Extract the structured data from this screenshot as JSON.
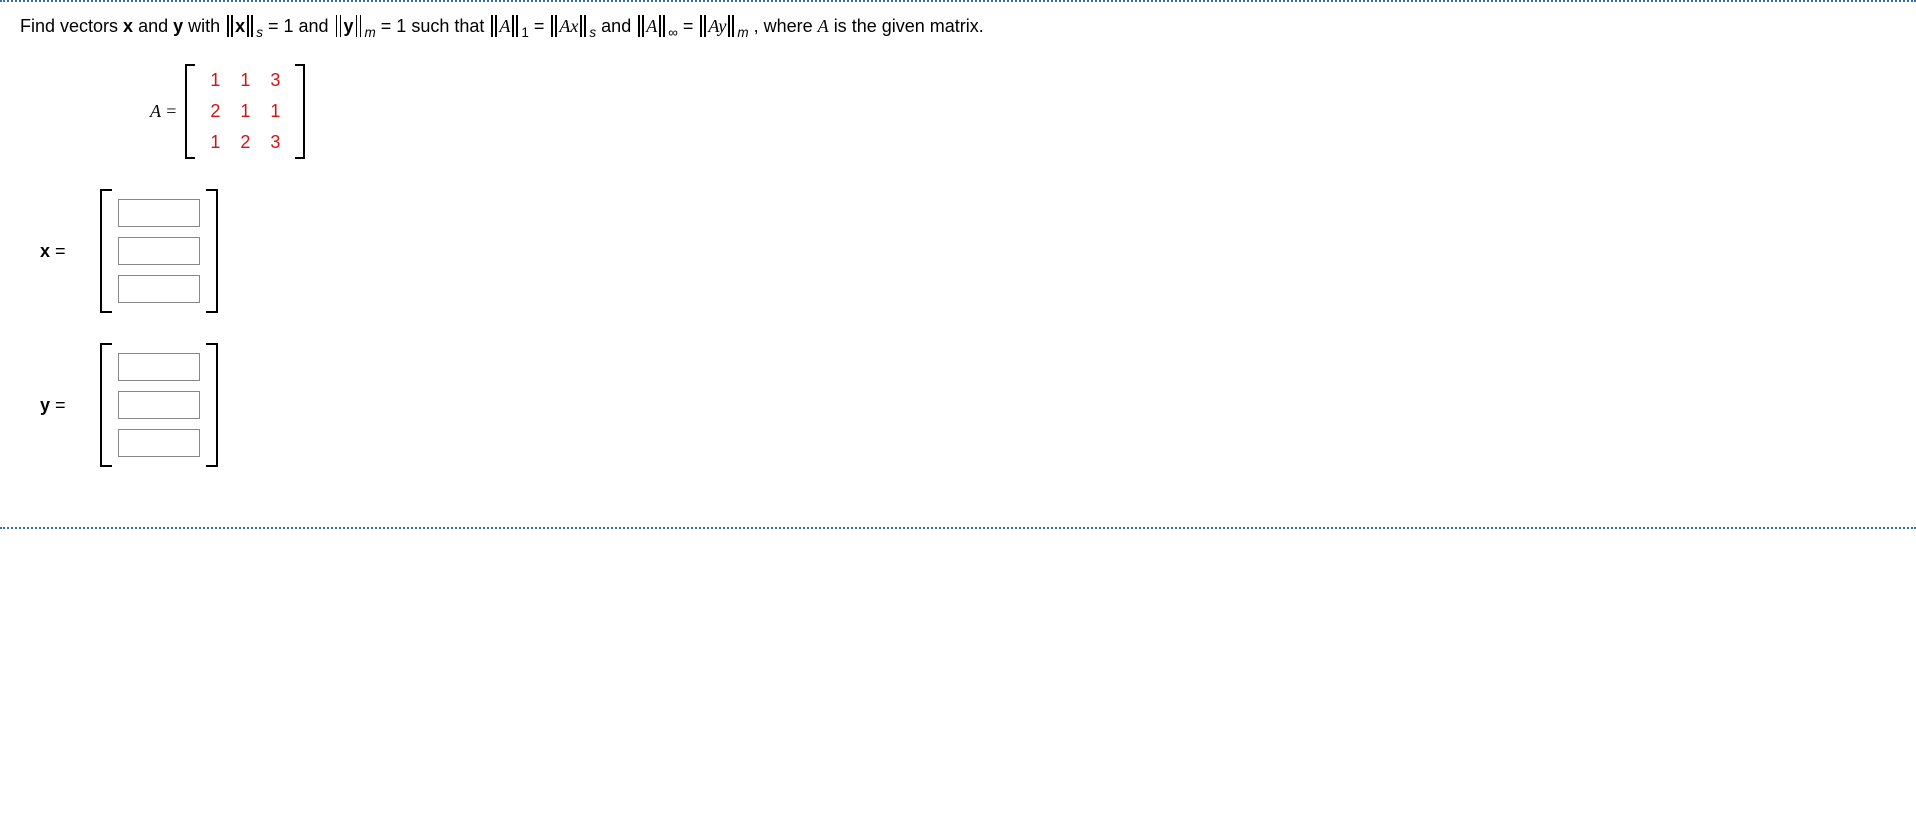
{
  "question": {
    "p1": "Find vectors ",
    "x": "x",
    "p2": " and ",
    "y": "y",
    "p3": " with ",
    "sub_s": "s",
    "eq1": " = 1 and ",
    "sub_m": "m",
    "eq1b": " = 1 such that ",
    "A": "A",
    "sub_1": "1",
    "eqsign": " = ",
    "Ax": "Ax",
    "p4": " and ",
    "sub_inf": "∞",
    "Ay": "Ay",
    "p5": ", where ",
    "p6": " is the given matrix."
  },
  "matrix": {
    "label": "A = ",
    "rows": [
      [
        "1",
        "1",
        "3"
      ],
      [
        "2",
        "1",
        "1"
      ],
      [
        "1",
        "2",
        "3"
      ]
    ]
  },
  "vx": {
    "label_bold": "x",
    "label_rest": "  =",
    "values": [
      "",
      "",
      ""
    ]
  },
  "vy": {
    "label_bold": "y",
    "label_rest": "  =",
    "values": [
      "",
      "",
      ""
    ]
  }
}
